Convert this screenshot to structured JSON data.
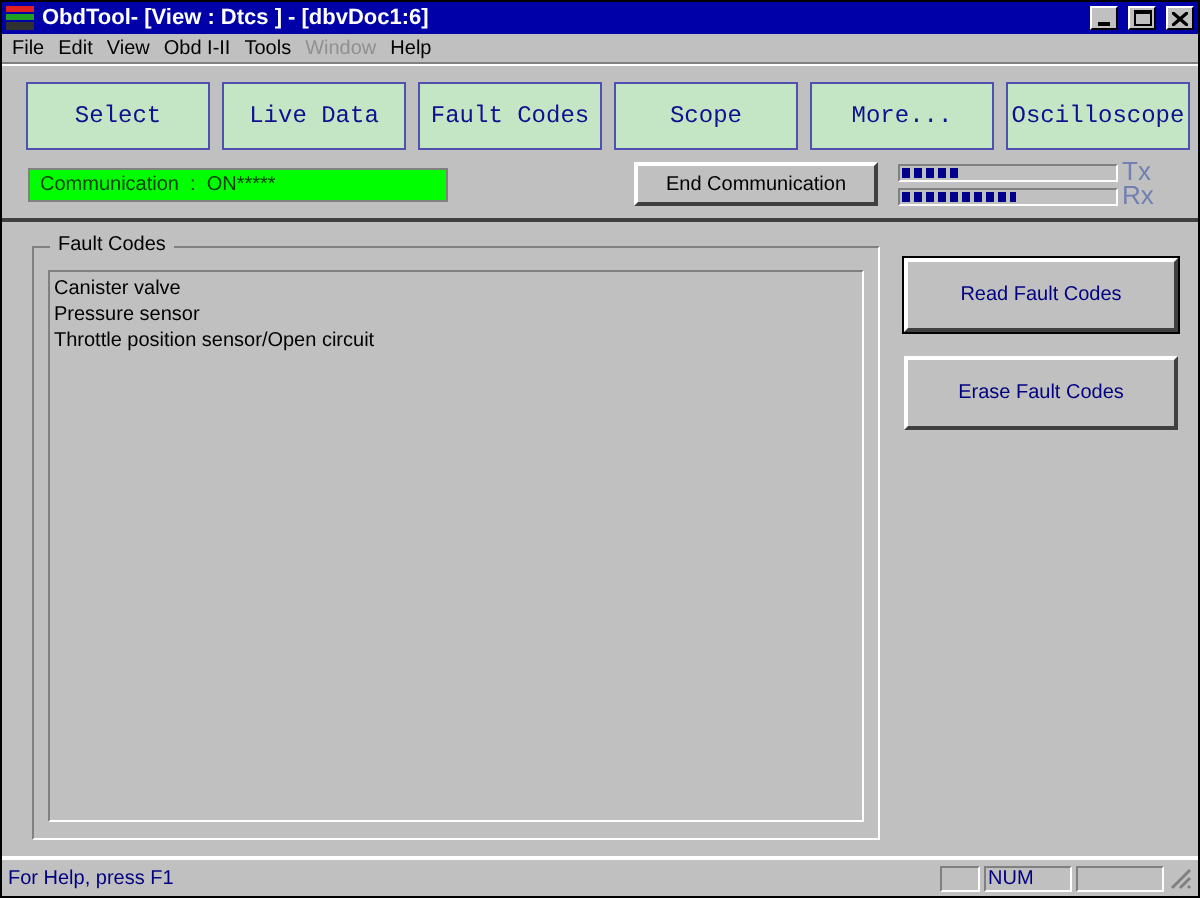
{
  "window": {
    "title": "ObdTool- [View : Dtcs ] - [dbvDoc1:6]"
  },
  "menu": [
    {
      "label": "File",
      "disabled": false
    },
    {
      "label": "Edit",
      "disabled": false
    },
    {
      "label": "View",
      "disabled": false
    },
    {
      "label": "Obd I-II",
      "disabled": false
    },
    {
      "label": "Tools",
      "disabled": false
    },
    {
      "label": "Window",
      "disabled": true
    },
    {
      "label": "Help",
      "disabled": false
    }
  ],
  "toolbar_buttons": [
    "Select",
    "Live Data",
    "Fault Codes",
    "Scope",
    "More...",
    "Oscilloscope"
  ],
  "communication_status": "Communication  :  ON*****",
  "end_button": "End Communication",
  "meters": [
    {
      "label": "Tx",
      "level": 0.26
    },
    {
      "label": "Rx",
      "level": 0.54
    }
  ],
  "fault_codes": {
    "title": "Fault Codes",
    "items": [
      "Canister valve",
      "Pressure sensor",
      "Throttle position sensor/Open circuit"
    ]
  },
  "actions": [
    {
      "label": "Read Fault Codes",
      "selected": true
    },
    {
      "label": "Erase Fault Codes",
      "selected": false
    }
  ],
  "status_bar": {
    "text": "For Help, press F1",
    "indicator": "NUM"
  }
}
